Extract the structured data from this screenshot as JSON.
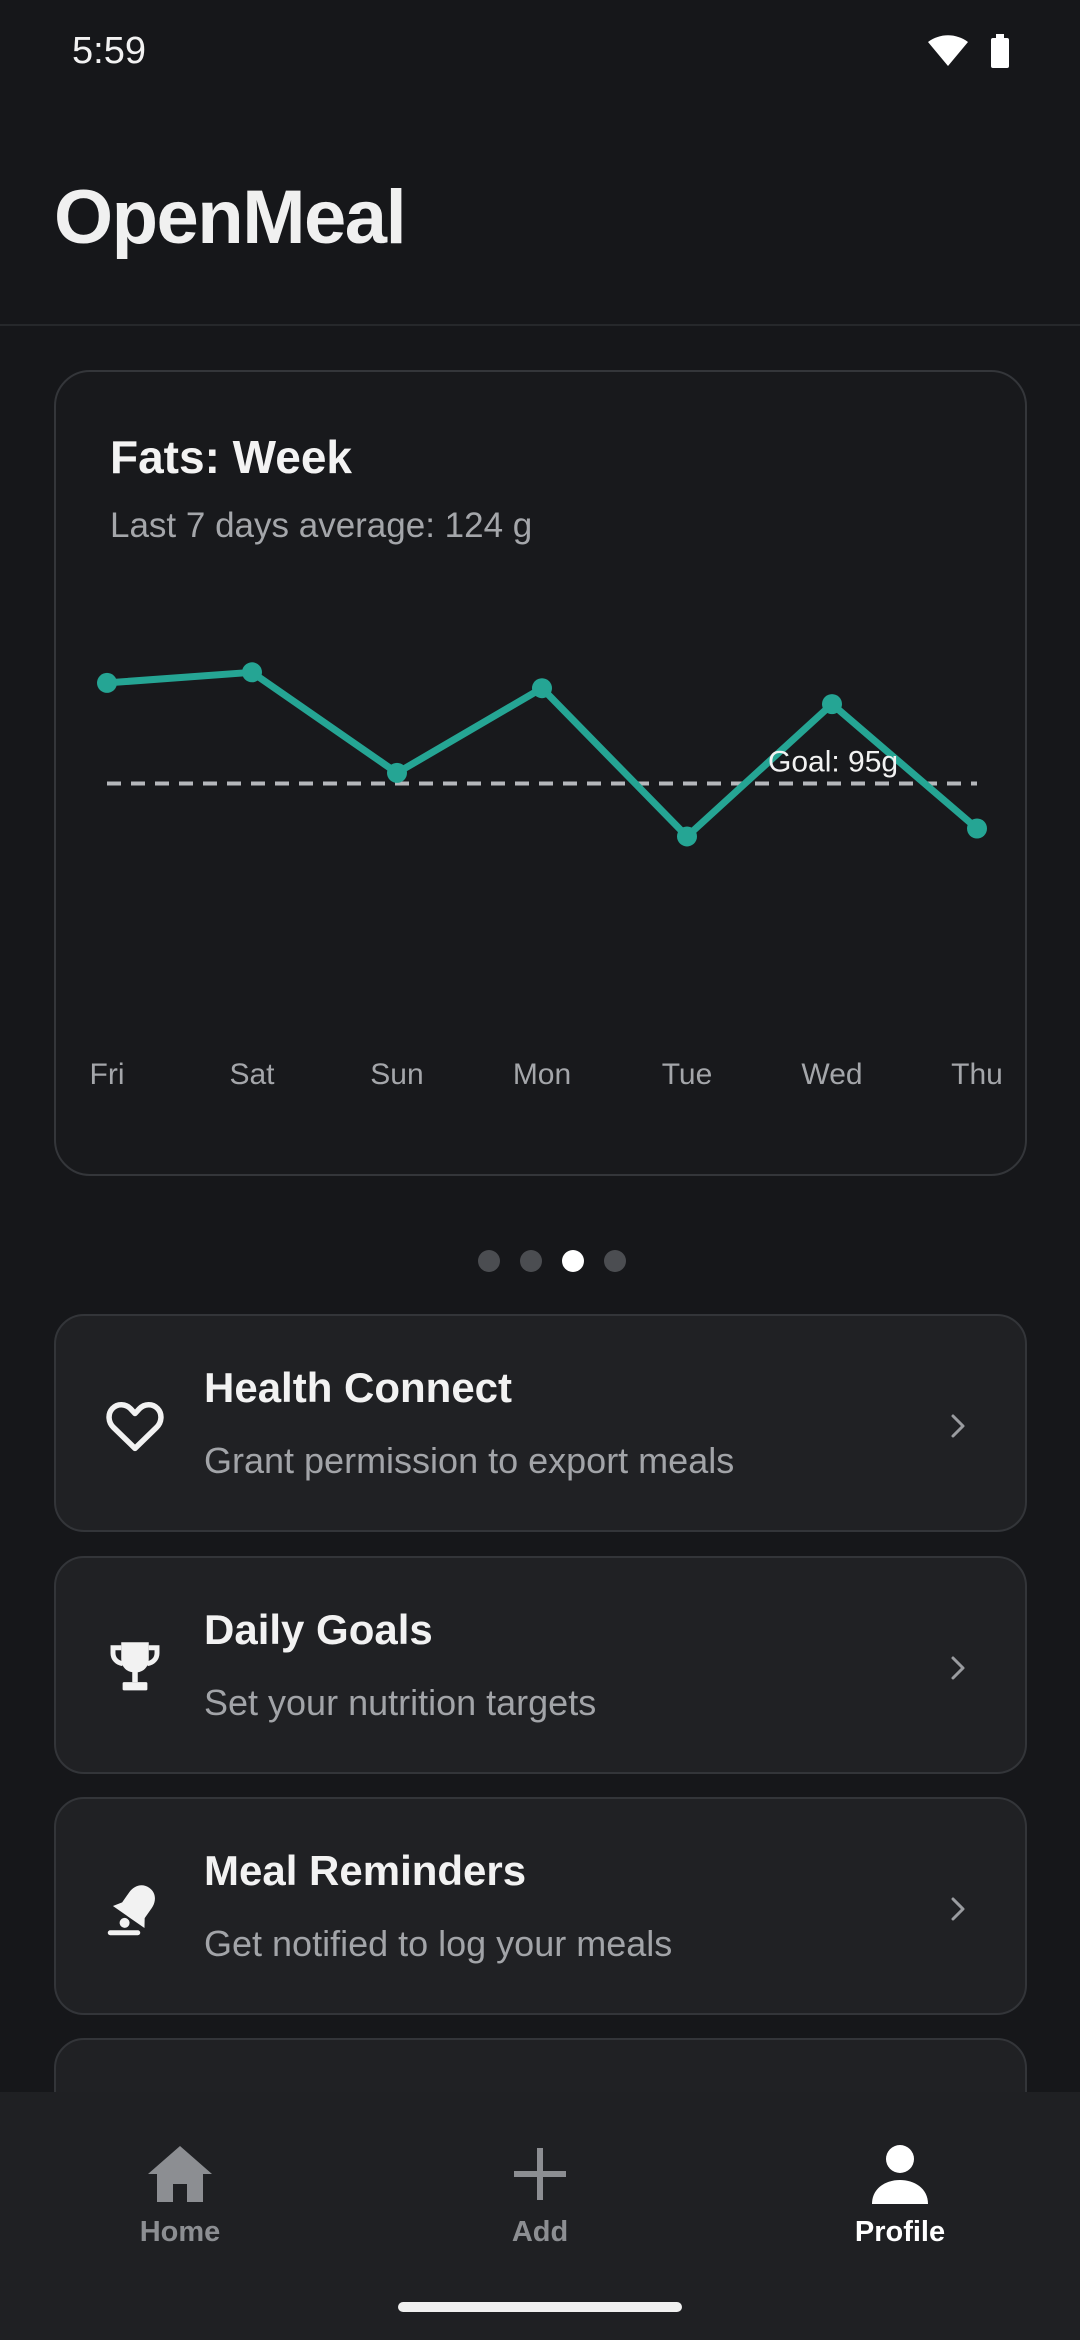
{
  "status": {
    "time": "5:59"
  },
  "app": {
    "title": "OpenMeal"
  },
  "chart_card": {
    "title": "Fats: Week",
    "subtitle": "Last 7 days average: 124 g",
    "goal_label": "Goal: 95g"
  },
  "chart_data": {
    "type": "line",
    "title": "Fats: Week",
    "subtitle": "Last 7 days average: 124 g",
    "x": [
      "Fri",
      "Sat",
      "Sun",
      "Mon",
      "Tue",
      "Wed",
      "Thu"
    ],
    "series": [
      {
        "values": [
          133,
          137,
          99,
          131,
          75,
          125,
          78
        ]
      }
    ],
    "reference_line": {
      "value": 95,
      "label": "Goal: 95g",
      "style": "dashed"
    },
    "xlabel": "",
    "ylabel": "",
    "ylim": [
      0,
      190
    ],
    "grid": false,
    "line_color": "#25a594"
  },
  "pager": {
    "count": 4,
    "active_index": 2
  },
  "menu": [
    {
      "title": "Health Connect",
      "subtitle": "Grant permission to export meals",
      "icon": "heart-icon"
    },
    {
      "title": "Daily Goals",
      "subtitle": "Set your nutrition targets",
      "icon": "trophy-icon"
    },
    {
      "title": "Meal Reminders",
      "subtitle": "Get notified to log your meals",
      "icon": "notification-bell-icon"
    }
  ],
  "nav": {
    "home": "Home",
    "add": "Add",
    "profile": "Profile",
    "active": "profile"
  },
  "colors": {
    "background": "#16171a",
    "card": "#202124",
    "accent": "#25a594",
    "muted_text": "#a2a4a8"
  }
}
